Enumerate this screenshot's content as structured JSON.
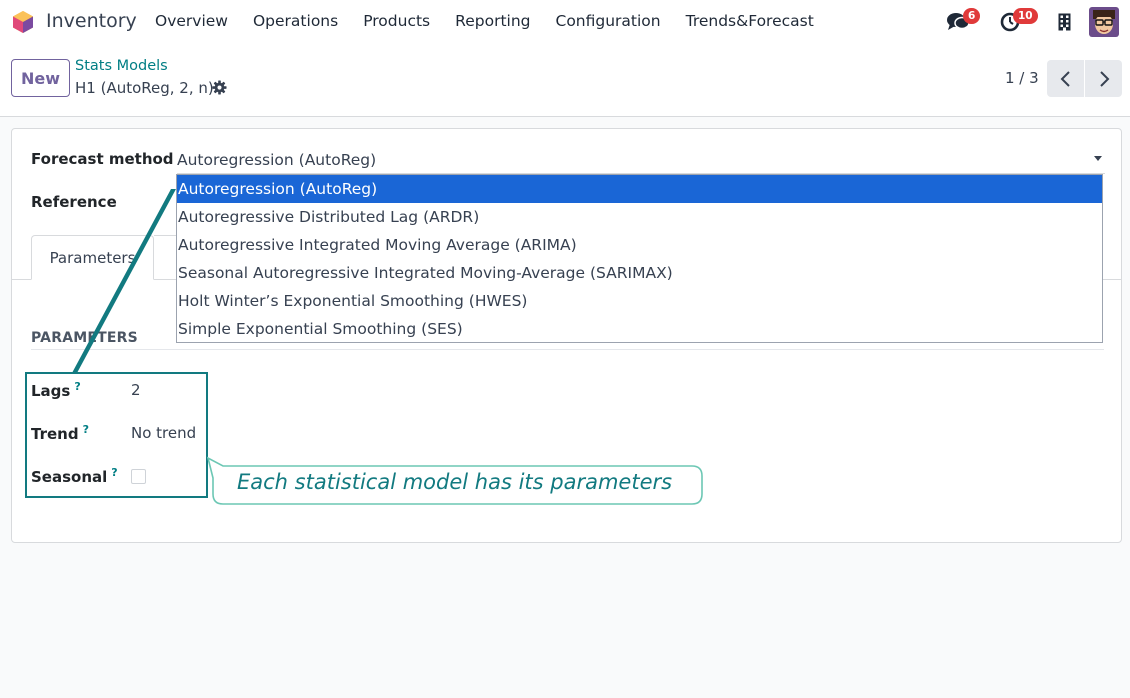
{
  "app": {
    "name": "Inventory"
  },
  "menu": [
    "Overview",
    "Operations",
    "Products",
    "Reporting",
    "Configuration",
    "Trends&Forecast"
  ],
  "notifications": {
    "messages_count": "6",
    "activities_count": "10"
  },
  "colors": {
    "accent": "#71639e",
    "link": "#017e84",
    "selected_option": "#1a66d6",
    "annotation": "#127a80",
    "badge": "#e03a3a"
  },
  "icons": [
    "chat-icon",
    "clock-icon",
    "building-icon",
    "avatar",
    "gear-icon",
    "chevron-left-icon",
    "chevron-right-icon"
  ],
  "control_panel": {
    "new_label": "New",
    "breadcrumb": "Stats Models",
    "record_name": "H1 (AutoReg, 2, n)",
    "pager": "1 / 3"
  },
  "form": {
    "forecast_method_label": "Forecast method",
    "forecast_method_value": "Autoregression (AutoReg)",
    "reference_label": "Reference",
    "tab_parameters": "Parameters",
    "group_title": "PARAMETERS",
    "lags_label": "Lags",
    "lags_value": "2",
    "trend_label": "Trend",
    "trend_value": "No trend",
    "seasonal_label": "Seasonal",
    "help_mark": "?"
  },
  "dropdown": {
    "options": [
      "Autoregression (AutoReg)",
      "Autoregressive Distributed Lag (ARDR)",
      "Autoregressive Integrated Moving Average (ARIMA)",
      "Seasonal Autoregressive Integrated Moving-Average (SARIMAX)",
      "Holt Winter’s Exponential Smoothing (HWES)",
      "Simple Exponential Smoothing (SES)"
    ],
    "selected": "Autoregression (AutoReg)"
  },
  "annotation": {
    "text": "Each statistical model has its parameters"
  }
}
